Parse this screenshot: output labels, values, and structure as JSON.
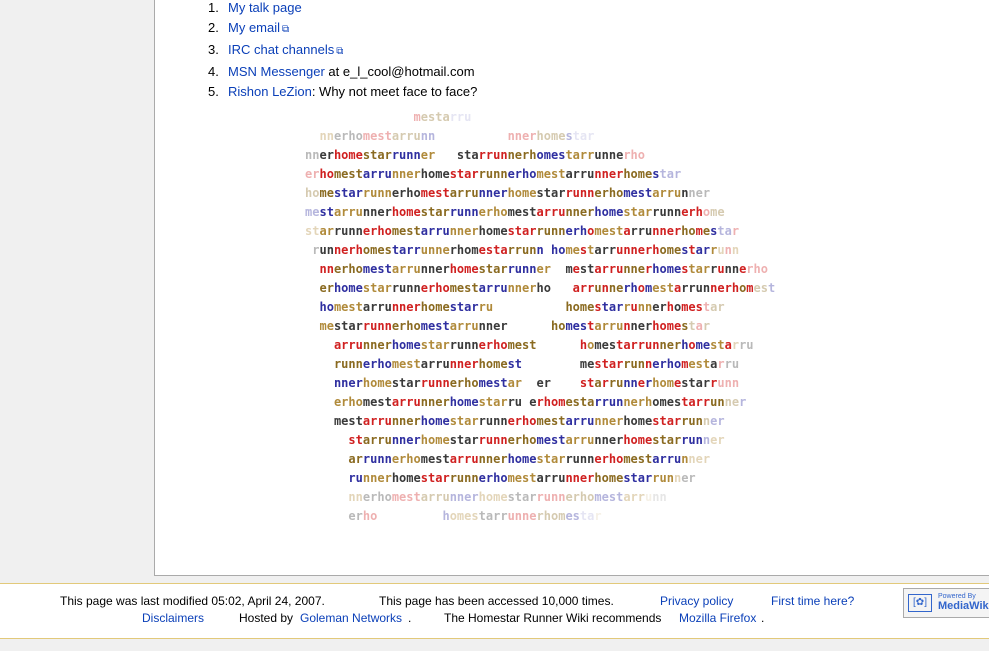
{
  "contacts": [
    {
      "num": "1.",
      "link": "My talk page",
      "external": false,
      "suffix": ""
    },
    {
      "num": "2.",
      "link": "My email",
      "external": true,
      "suffix": ""
    },
    {
      "num": "3.",
      "link": "IRC chat channels",
      "external": true,
      "suffix": ""
    },
    {
      "num": "4.",
      "link": "MSN Messenger",
      "external": false,
      "suffix": " at e_l_cool@hotmail.com"
    },
    {
      "num": "5.",
      "link": "Rishon LeZion",
      "external": false,
      "suffix": ": Why not meet face to face?"
    }
  ],
  "ascii_art": [
    "               mestarru",
    "  nnerhomestarrunn          nnerhomestar",
    "nnerhomestarrunner   starrunnerhomestarrunnerho",
    "erhomestarrunnerhomestarrunnerhomestarrunnerhomestar",
    "homestarrunnerhomestarrunnerhomestarrunnerhomestarrunner",
    "mestarrunnerhomestarrunnerhomestarrunnerhomestarrunnerhome",
    "starrunnerhomestarrunnerhomestarrunnerhomestarrunnerhomestar",
    " runnerhomestarrunnerhomestarrunn homestarrunnerhomestarrunn",
    "  nnerhomestarrunnerhomestarrunner  mestarrunnerhomestarrunnerho",
    "  erhomestarrunnerhomestarrunnerho   arrunnerhomestarrunnerhomest",
    "  homestarrunnerhomestarru          homestarrunnerhomestar",
    "  mestarrunnerhomestarrunner      homestarrunnerhomestar",
    "    arrunnerhomestarrunnerhomest      homestarrunnerhomestarru",
    "    runnerhomestarrunnerhomest        mestarrunnerhomestarru",
    "    nnerhomestarrunnerhomestar  er    starrunnerhomestarrunn",
    "    erhomestarrunnerhomestarru erhomestarrunnerhomestarrunner",
    "    mestarrunnerhomestarrunnerhomestarrunnerhomestarrunner",
    "      starrunnerhomestarrunnerhomestarrunnerhomestarrunner",
    "      arrunnerhomestarrunnerhomestarrunnerhomestarrunner",
    "      runnerhomestarrunnerhomestarrunnerhomestarrunner",
    "      nnerhomestarrunnerhomestarrunnerhomestarrunn",
    "      erho         homestarrunnerhomestar"
  ],
  "footer": {
    "last_modified": "This page was last modified 05:02, April 24, 2007.",
    "accessed": "This page has been accessed 10,000 times.",
    "privacy": "Privacy policy",
    "first_time": "First time here?",
    "disclaimers": "Disclaimers",
    "hosted_by": "Hosted by",
    "goleman": "Goleman Networks",
    "period1": ".",
    "recommends": "The Homestar Runner Wiki recommends",
    "firefox": "Mozilla Firefox",
    "period2": ".",
    "badge_line1": "Powered By",
    "badge_line2": "MediaWiki"
  },
  "colors": {
    "link": "#0a3fb8",
    "footer_border": "#e2c97a",
    "ascii_palette": [
      "#2f2fa0",
      "#b08a3a",
      "#3a3a3a",
      "#d02020",
      "#8a6a20"
    ]
  }
}
